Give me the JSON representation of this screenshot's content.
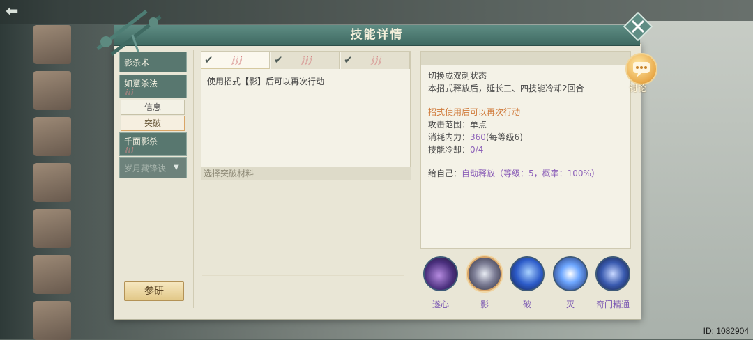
{
  "header": {
    "title": "技能详情"
  },
  "skills": [
    {
      "name": "影杀术",
      "stars": ""
    },
    {
      "name": "如意杀法",
      "stars": "ⅉⅉⅉ"
    },
    {
      "name": "千面影杀",
      "stars": "ⅉⅉⅉ"
    },
    {
      "name": "岁月藏锋诀",
      "stars": ""
    }
  ],
  "sub_tabs": {
    "info": "信息",
    "breakthrough": "突破"
  },
  "research_button": "参研",
  "breakthrough": {
    "tab_stars": [
      "ⅉⅉⅉ",
      "ⅉⅉⅉ",
      "ⅉⅉⅉ"
    ],
    "description": "使用招式【影】后可以再次行动",
    "material_bar": "选择突破材料"
  },
  "detail": {
    "line1": "切换成双刺状态",
    "line2": "本招式释放后，延长三、四技能冷却2回合",
    "extra": "招式使用后可以再次行动",
    "range_label": "攻击范围：",
    "range_value": "单点",
    "cost_label": "消耗内力：",
    "cost_value": "360",
    "cost_suffix": "(每等级6)",
    "cooldown_label": "技能冷却：",
    "cooldown_value": "0/4",
    "self_label": "给自己：",
    "self_value": "自动释放（等级：5，概率：100%）"
  },
  "discuss": {
    "label": "讨论"
  },
  "skill_icons": [
    {
      "label": "遂心",
      "selected": false
    },
    {
      "label": "影",
      "selected": true
    },
    {
      "label": "破",
      "selected": false
    },
    {
      "label": "灭",
      "selected": false
    },
    {
      "label": "奇门精通",
      "selected": false
    }
  ],
  "watermark": {
    "id": "ID: 1082904"
  }
}
